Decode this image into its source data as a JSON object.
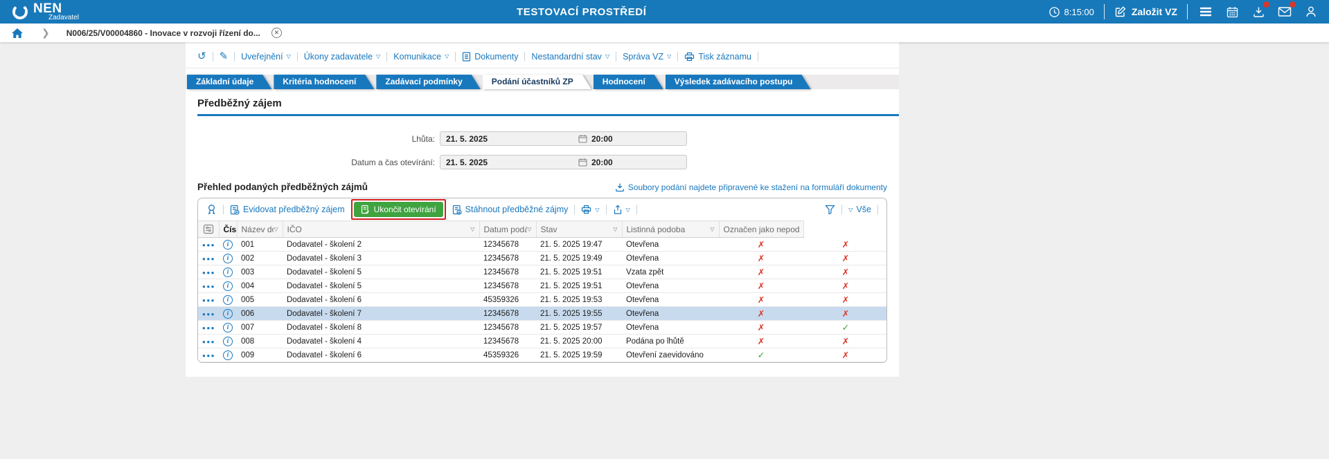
{
  "colors": {
    "header_blue": "#1879ba",
    "accent_blue": "#1878be",
    "active_tab_text": "#16395e",
    "green_button": "#3fa33f",
    "annotation_red": "#d42020",
    "check_green": "#2ca32c",
    "cross_red": "#dc3425",
    "selected_row_bg": "#c8dbee"
  },
  "topbar": {
    "brand": "NEN",
    "brand_role": "Zadavatel",
    "environment_title": "TESTOVACÍ PROSTŘEDÍ",
    "time": "8:15:00",
    "create_vz_label": "Založit VZ"
  },
  "breadcrumb": {
    "current_item": "N006/25/V00004860 - Inovace v rozvoji řízení do..."
  },
  "record_toolbar": {
    "items": [
      {
        "label": "Uveřejnění",
        "dropdown": true
      },
      {
        "label": "Úkony zadavatele",
        "dropdown": true
      },
      {
        "label": "Komunikace",
        "dropdown": true
      },
      {
        "label": "Dokumenty",
        "dropdown": false,
        "icon": "document-icon"
      },
      {
        "label": "Nestandardní stav",
        "dropdown": true
      },
      {
        "label": "Správa VZ",
        "dropdown": true
      },
      {
        "label": "Tisk záznamu",
        "dropdown": false,
        "icon": "printer-icon"
      }
    ]
  },
  "tabs": [
    {
      "label": "Základní údaje",
      "active": false
    },
    {
      "label": "Kritéria hodnocení",
      "active": false
    },
    {
      "label": "Zadávací podmínky",
      "active": false
    },
    {
      "label": "Podání účastníků ZP",
      "active": true
    },
    {
      "label": "Hodnocení",
      "active": false
    },
    {
      "label": "Výsledek zadávacího postupu",
      "active": false
    }
  ],
  "section_title": "Předběžný zájem",
  "form_fields": [
    {
      "label": "Lhůta:",
      "date": "21. 5. 2025",
      "time": "20:00"
    },
    {
      "label": "Datum a čas otevírání:",
      "date": "21. 5. 2025",
      "time": "20:00"
    }
  ],
  "submissions": {
    "heading": "Přehled podaných předběžných zájmů",
    "files_link_label": "Soubory podání najdete připravené ke stažení na formuláři dokumenty",
    "actions": {
      "evidovat_label": "Evidovat předběžný zájem",
      "ukoncit_label": "Ukončit otevírání",
      "stahnout_label": "Stáhnout předběžné zájmy",
      "filter_all_label": "Vše"
    },
    "columns": [
      {
        "key": "cislo",
        "label": "Číslo",
        "sorted": "asc"
      },
      {
        "key": "nazev",
        "label": "Název dodavatele"
      },
      {
        "key": "ico",
        "label": "IČO"
      },
      {
        "key": "datum",
        "label": "Datum podání"
      },
      {
        "key": "stav",
        "label": "Stav"
      },
      {
        "key": "listinna",
        "label": "Listinná podoba"
      },
      {
        "key": "nepodany",
        "label": "Označen jako nepodaný"
      }
    ],
    "marks": {
      "yes": "✓",
      "no": "✗"
    },
    "rows": [
      {
        "cislo": "001",
        "nazev": "Dodavatel - školení 2",
        "ico": "12345678",
        "datum": "21. 5. 2025 19:47",
        "stav": "Otevřena",
        "listinna": "no",
        "nepodany": "no",
        "selected": false
      },
      {
        "cislo": "002",
        "nazev": "Dodavatel - školení 3",
        "ico": "12345678",
        "datum": "21. 5. 2025 19:49",
        "stav": "Otevřena",
        "listinna": "no",
        "nepodany": "no",
        "selected": false
      },
      {
        "cislo": "003",
        "nazev": "Dodavatel - školení 5",
        "ico": "12345678",
        "datum": "21. 5. 2025 19:51",
        "stav": "Vzata zpět",
        "listinna": "no",
        "nepodany": "no",
        "selected": false
      },
      {
        "cislo": "004",
        "nazev": "Dodavatel - školení 5",
        "ico": "12345678",
        "datum": "21. 5. 2025 19:51",
        "stav": "Otevřena",
        "listinna": "no",
        "nepodany": "no",
        "selected": false
      },
      {
        "cislo": "005",
        "nazev": "Dodavatel - školení 6",
        "ico": "45359326",
        "datum": "21. 5. 2025 19:53",
        "stav": "Otevřena",
        "listinna": "no",
        "nepodany": "no",
        "selected": false
      },
      {
        "cislo": "006",
        "nazev": "Dodavatel - školení 7",
        "ico": "12345678",
        "datum": "21. 5. 2025 19:55",
        "stav": "Otevřena",
        "listinna": "no",
        "nepodany": "no",
        "selected": true
      },
      {
        "cislo": "007",
        "nazev": "Dodavatel - školení 8",
        "ico": "12345678",
        "datum": "21. 5. 2025 19:57",
        "stav": "Otevřena",
        "listinna": "no",
        "nepodany": "yes",
        "selected": false
      },
      {
        "cislo": "008",
        "nazev": "Dodavatel - školení 4",
        "ico": "12345678",
        "datum": "21. 5. 2025 20:00",
        "stav": "Podána po lhůtě",
        "listinna": "no",
        "nepodany": "no",
        "selected": false
      },
      {
        "cislo": "009",
        "nazev": "Dodavatel - školení 6",
        "ico": "45359326",
        "datum": "21. 5. 2025 19:59",
        "stav": "Otevření zaevidováno",
        "listinna": "yes",
        "nepodany": "no",
        "selected": false
      }
    ]
  }
}
